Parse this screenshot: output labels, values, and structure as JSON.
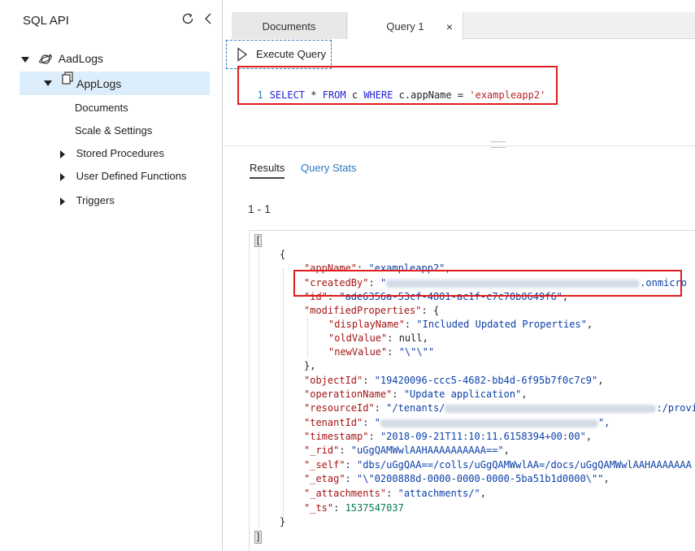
{
  "sidebar": {
    "title": "SQL API",
    "database": "AadLogs",
    "collection": "AppLogs",
    "items": [
      {
        "label": "Documents"
      },
      {
        "label": "Scale & Settings"
      },
      {
        "label": "Stored Procedures"
      },
      {
        "label": "User Defined Functions"
      },
      {
        "label": "Triggers"
      }
    ]
  },
  "tabs": [
    {
      "label": "Documents"
    },
    {
      "label": "Query 1",
      "close": "×"
    }
  ],
  "toolbar": {
    "execute_label": "Execute Query"
  },
  "editor": {
    "line_number": "1",
    "kw_select": "SELECT",
    "star": " * ",
    "kw_from": "FROM",
    "alias": " c ",
    "kw_where": "WHERE",
    "cond": " c.appName = ",
    "value": "'exampleapp2'"
  },
  "results": {
    "tab_results": "Results",
    "tab_stats": "Query Stats",
    "range": "1 - 1"
  },
  "json": {
    "open_bracket": "[",
    "open_brace": "{",
    "appName_key": "\"appName\"",
    "appName_val": "\"exampleapp2\"",
    "createdBy_key": "\"createdBy\"",
    "createdBy_tail": ".onmicro",
    "id_key": "\"id\"",
    "id_val": "\"ade6356a-53cf-4801-ac1f-c7c70b0649f6\"",
    "modprops_key": "\"modifiedProperties\"",
    "displayName_key": "\"displayName\"",
    "displayName_val": "\"Included Updated Properties\"",
    "oldValue_key": "\"oldValue\"",
    "oldValue_val": "null",
    "newValue_key": "\"newValue\"",
    "newValue_val": "\"\\\"\\\"\"",
    "close_brace_comma": "},",
    "objectId_key": "\"objectId\"",
    "objectId_val": "\"19420096-ccc5-4682-bb4d-6f95b7f0c7c9\"",
    "operationName_key": "\"operationName\"",
    "operationName_val": "\"Update application\"",
    "resourceId_key": "\"resourceId\"",
    "resourceId_val": "\"/tenants/",
    "resourceId_tail": ":/provi",
    "tenantId_key": "\"tenantId\"",
    "timestamp_key": "\"timestamp\"",
    "timestamp_val": "\"2018-09-21T11:10:11.6158394+00:00\"",
    "rid_key": "\"_rid\"",
    "rid_val": "\"uGgQAMWwlAAHAAAAAAAAAA==\"",
    "self_key": "\"_self\"",
    "self_val": "\"dbs/uGgQAA==/colls/uGgQAMWwlAA=/docs/uGgQAMWwlAAHAAAAAAA",
    "etag_key": "\"_etag\"",
    "etag_val": "\"\\\"0200888d-0000-0000-0000-5ba51b1d0000\\\"\"",
    "attachments_key": "\"_attachments\"",
    "attachments_val": "\"attachments/\"",
    "ts_key": "\"_ts\"",
    "ts_val": "1537547037",
    "close_brace": "}",
    "close_bracket": "]"
  },
  "colors": {
    "accent": "#2b79c2",
    "highlight_red": "#e01b1b",
    "selected_bg": "#dceefb"
  }
}
